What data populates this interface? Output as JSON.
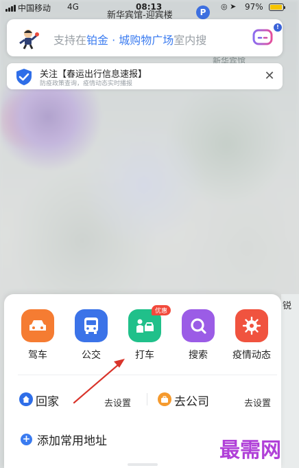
{
  "status_bar": {
    "carrier": "中国移动",
    "network": "4G",
    "time": "08:13",
    "location_name": "新华宾馆-迎宾楼",
    "parking": "P",
    "battery": "97%",
    "battery_level": 0.97
  },
  "search": {
    "prefix": "支持在",
    "highlight": "铂金 · 城购物广场",
    "suffix": "室内搜",
    "badge": "!"
  },
  "notice": {
    "title": "关注【春运出行信息速报】",
    "subtitle": "防疫政策查询，疫情动态实时播报",
    "close": "✕"
  },
  "map_labels": {
    "hotel": "新华宾馆",
    "right_char": "锐"
  },
  "quick_actions": [
    {
      "label": "驾车",
      "icon": "car-icon",
      "color": "#f57c32"
    },
    {
      "label": "公交",
      "icon": "bus-icon",
      "color": "#3b73e8"
    },
    {
      "label": "打车",
      "icon": "taxi-icon",
      "color": "#20c08a",
      "badge": "优惠"
    },
    {
      "label": "搜索",
      "icon": "search-icon",
      "color": "#9b5ce6"
    },
    {
      "label": "疫情动态",
      "icon": "virus-icon",
      "color": "#f0533f"
    }
  ],
  "addresses": {
    "home": {
      "label": "回家",
      "action": "去设置"
    },
    "work": {
      "label": "去公司",
      "action": "去设置"
    },
    "add": {
      "label": "添加常用地址"
    }
  },
  "watermark": "最需网"
}
